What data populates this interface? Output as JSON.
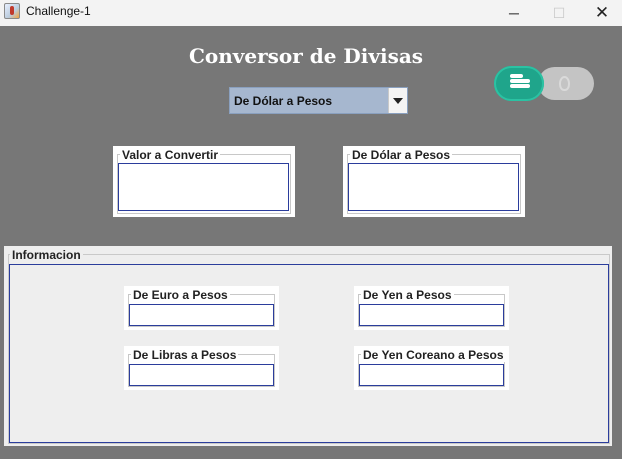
{
  "window": {
    "title": "Challenge-1",
    "controls": {
      "minimize": "─",
      "maximize": "☐",
      "close": "✕"
    }
  },
  "header": {
    "title": "Conversor de Divisas"
  },
  "converter": {
    "selected_option": "De Dólar a Pesos",
    "input_panel": {
      "title": "Valor a Convertir",
      "value": ""
    },
    "output_panel": {
      "title": "De Dólar a Pesos",
      "value": ""
    }
  },
  "toggle": {
    "state": "on",
    "on_icon": "coins-icon",
    "off_icon": "thermometer-icon"
  },
  "info": {
    "title": "Informacion",
    "fields": [
      {
        "title": "De Euro a Pesos",
        "value": ""
      },
      {
        "title": "De Yen a Pesos",
        "value": ""
      },
      {
        "title": "De Libras a Pesos",
        "value": ""
      },
      {
        "title": "De Yen Coreano a Pesos",
        "value": ""
      }
    ]
  },
  "colors": {
    "background": "#777777",
    "combo": "#a6b7cf",
    "toggle_on": "#1fa58b",
    "field_border": "#2b3d9c",
    "info_background": "#eeeeee"
  }
}
